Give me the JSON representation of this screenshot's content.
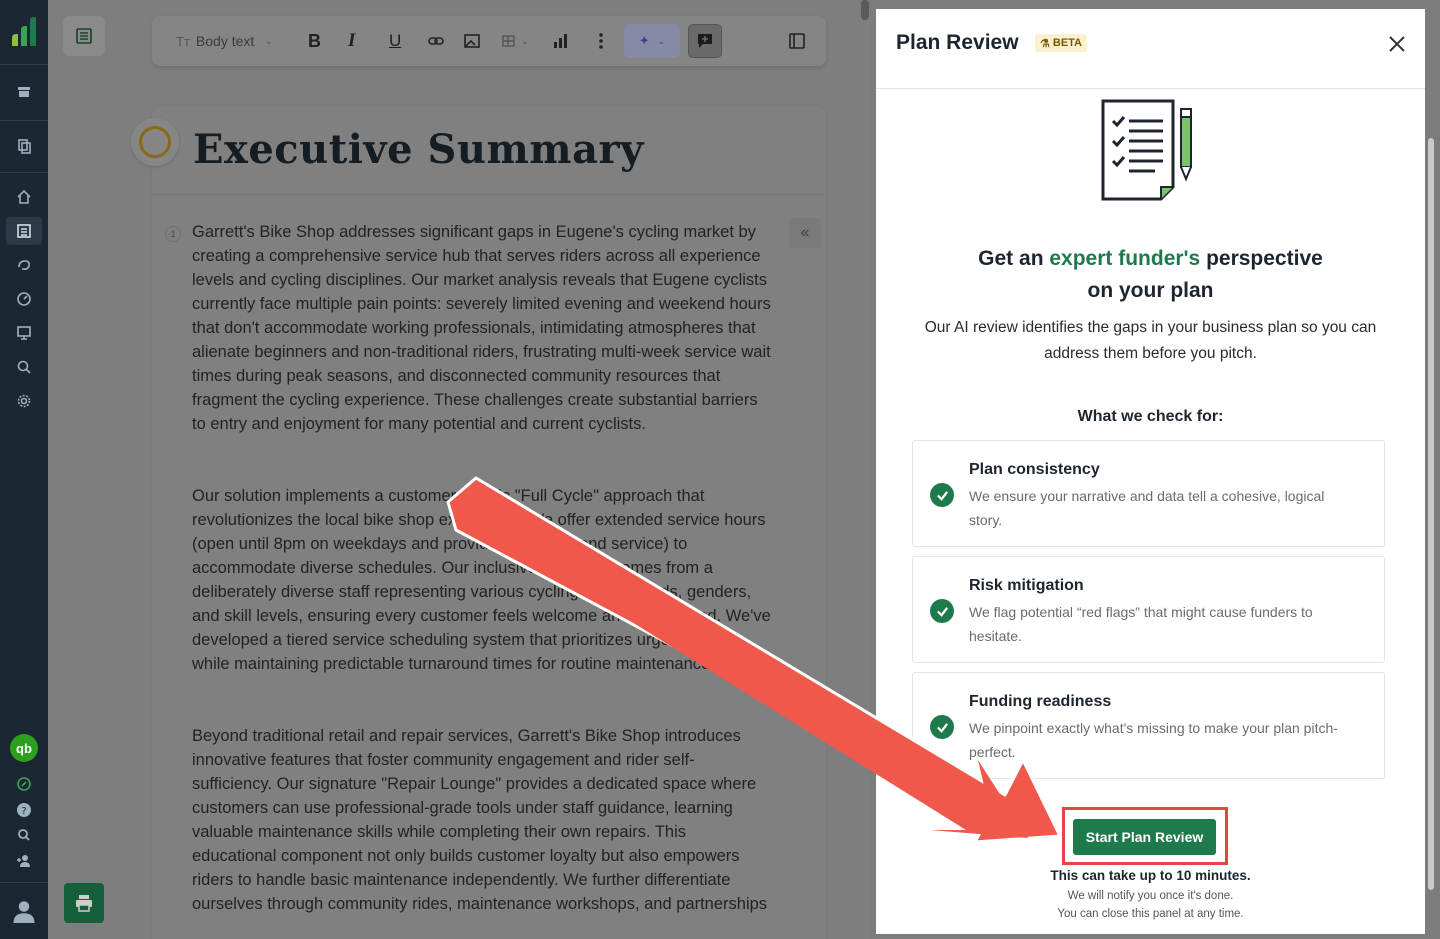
{
  "toolbar": {
    "style_select": "Body text",
    "bold": "B",
    "italic": "I",
    "underline": "U"
  },
  "document": {
    "title": "Executive Summary",
    "paragraph_number": "1",
    "paragraphs": [
      "Garrett's Bike Shop addresses significant gaps in Eugene's cycling market by creating a comprehensive service hub that serves riders across all experience levels and cycling disciplines. Our market analysis reveals that Eugene cyclists currently face multiple pain points: severely limited evening and weekend hours that don't accommodate working professionals, intimidating atmospheres that alienate beginners and non-traditional riders, frustrating multi-week service wait times during peak seasons, and disconnected community resources that fragment the cycling experience. These challenges create substantial barriers to entry and enjoyment for many potential and current cyclists.",
      "Our solution implements a customer-centric \"Full Cycle\" approach that revolutionizes the local bike shop experience. We offer extended service hours (open until 8pm on weekdays and providing full weekend service) to accommodate diverse schedules. Our inclusive expertise comes from a deliberately diverse staff representing various cycling backgrounds, genders, and skill levels, ensuring every customer feels welcome and understood. We've developed a tiered service scheduling system that prioritizes urgent repairs while maintaining predictable turnaround times for routine maintenance.",
      "Beyond traditional retail and repair services, Garrett's Bike Shop introduces innovative features that foster community engagement and rider self-sufficiency. Our signature \"Repair Lounge\" provides a dedicated space where customers can use professional-grade tools under staff guidance, learning valuable maintenance skills while completing their own repairs. This educational component not only builds customer loyalty but also empowers riders to handle basic maintenance independently. We further differentiate ourselves through community rides, maintenance workshops, and partnerships"
    ]
  },
  "panel": {
    "title": "Plan Review",
    "badge": "BETA",
    "headline_pre": "Get an ",
    "headline_highlight": "expert funder's",
    "headline_post": " perspective",
    "headline_line2": "on your plan",
    "subtitle": "Our AI review identifies the gaps in your business plan so you can address them before you pitch.",
    "checks_heading": "What we check for:",
    "checks": [
      {
        "title": "Plan consistency",
        "desc": "We ensure your narrative and data tell a cohesive, logical story."
      },
      {
        "title": "Risk mitigation",
        "desc": "We flag potential “red flags” that might cause funders to hesitate."
      },
      {
        "title": "Funding readiness",
        "desc": "We pinpoint exactly what's missing to make your plan pitch-perfect."
      }
    ],
    "start_button": "Start Plan Review",
    "time_note": "This can take up to 10 minutes.",
    "notify_note": "We will notify you once it's done.",
    "close_note": "You can close this panel at any time."
  },
  "colors": {
    "brand_green": "#1f7a4b",
    "nav_bg": "#1b2733",
    "highlight_red": "#e2483f",
    "beta_bg": "#fbf0cf"
  }
}
